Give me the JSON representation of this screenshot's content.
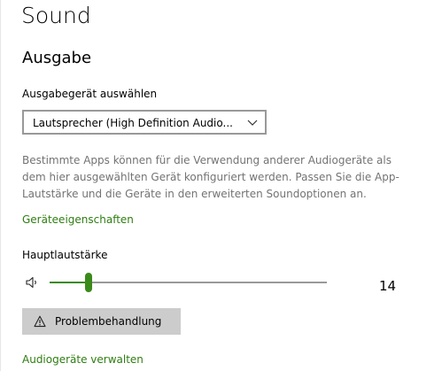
{
  "page": {
    "title": "Sound"
  },
  "output": {
    "section_title": "Ausgabe",
    "device_label": "Ausgabegerät auswählen",
    "device_selected": "Lautsprecher (High Definition Audio...",
    "description": "Bestimmte Apps können für die Verwendung anderer Audiogeräte als dem hier ausgewählten Gerät konfiguriert werden. Passen Sie die App-Lautstärke und die Geräte in den erweiterten Soundoptionen an.",
    "device_properties_link": "Geräteeigenschaften",
    "volume_label": "Hauptlautstärke",
    "volume_value": "14",
    "volume_level": 14,
    "troubleshoot_button": "Problembehandlung",
    "manage_devices_link": "Audiogeräte verwalten"
  },
  "colors": {
    "accent": "#3a8a1a",
    "link": "#2e7d11",
    "description_text": "#737373",
    "button_background": "#cccccc"
  },
  "icons": {
    "speaker": "speaker-icon",
    "dropdown": "chevron-down-icon",
    "troubleshoot": "warning-icon"
  }
}
